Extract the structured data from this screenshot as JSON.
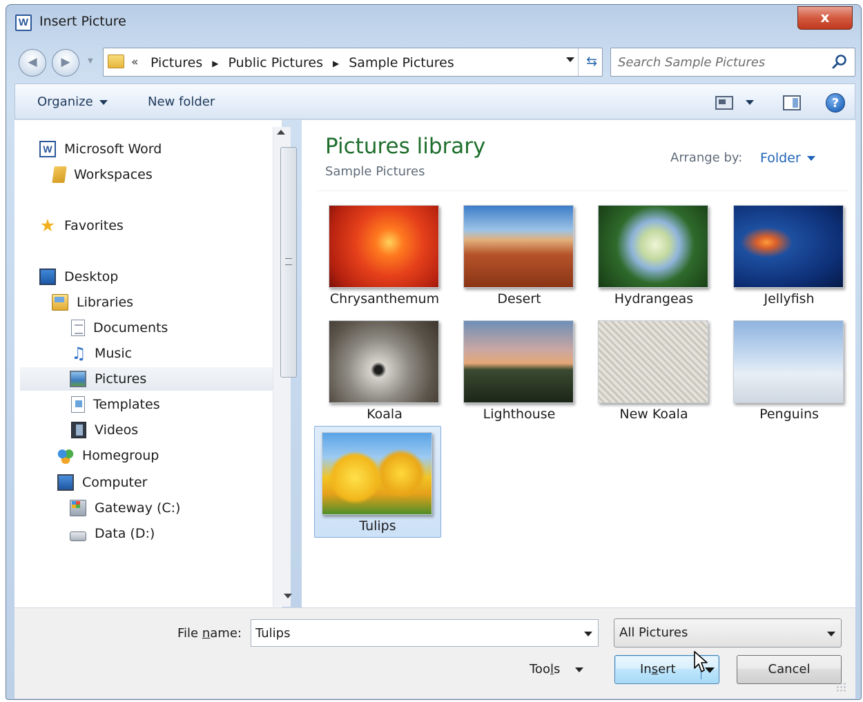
{
  "window": {
    "title": "Insert Picture",
    "app_icon": "word-icon",
    "close_icon": "close-icon",
    "close_glyph": "x"
  },
  "address": {
    "crumbs": [
      "Pictures",
      "Public Pictures",
      "Sample Pictures"
    ],
    "prefix": "«",
    "search_placeholder": "Search Sample Pictures"
  },
  "toolbar": {
    "organize_label": "Organize",
    "new_folder_label": "New folder",
    "help_glyph": "?"
  },
  "nav": {
    "items": [
      {
        "label": "Microsoft Word",
        "icon": "word-icon"
      },
      {
        "label": "Workspaces",
        "icon": "workspace-icon"
      },
      {
        "label": "Favorites",
        "icon": "star-icon"
      },
      {
        "label": "Desktop",
        "icon": "desktop-icon"
      },
      {
        "label": "Libraries",
        "icon": "libraries-icon"
      },
      {
        "label": "Documents",
        "icon": "document-icon"
      },
      {
        "label": "Music",
        "icon": "music-icon"
      },
      {
        "label": "Pictures",
        "icon": "pictures-icon",
        "selected": true
      },
      {
        "label": "Templates",
        "icon": "templates-icon"
      },
      {
        "label": "Videos",
        "icon": "videos-icon"
      },
      {
        "label": "Homegroup",
        "icon": "homegroup-icon"
      },
      {
        "label": "Computer",
        "icon": "computer-icon"
      },
      {
        "label": "Gateway (C:)",
        "icon": "drive-icon"
      },
      {
        "label": "Data (D:)",
        "icon": "drive-icon"
      }
    ]
  },
  "content": {
    "library_title": "Pictures library",
    "library_subtitle": "Sample Pictures",
    "arrange_label": "Arrange by:",
    "arrange_value": "Folder",
    "items": [
      {
        "name": "Chrysanthemum"
      },
      {
        "name": "Desert"
      },
      {
        "name": "Hydrangeas"
      },
      {
        "name": "Jellyfish"
      },
      {
        "name": "Koala"
      },
      {
        "name": "Lighthouse"
      },
      {
        "name": "New Koala"
      },
      {
        "name": "Penguins"
      },
      {
        "name": "Tulips",
        "selected": true
      }
    ]
  },
  "footer": {
    "file_name_label_pre": "File ",
    "file_name_label_key": "n",
    "file_name_label_post": "ame:",
    "file_name_value": "Tulips",
    "filter_value": "All Pictures",
    "tools_label_pre": "Too",
    "tools_label_key": "l",
    "tools_label_post": "s",
    "insert_label_pre": "In",
    "insert_label_key": "s",
    "insert_label_post": "ert",
    "cancel_label": "Cancel"
  },
  "colors": {
    "library_title": "#1e6e2c",
    "link_blue": "#1f63b8",
    "close_red": "#c0391f",
    "selection": "#cde1f7"
  }
}
